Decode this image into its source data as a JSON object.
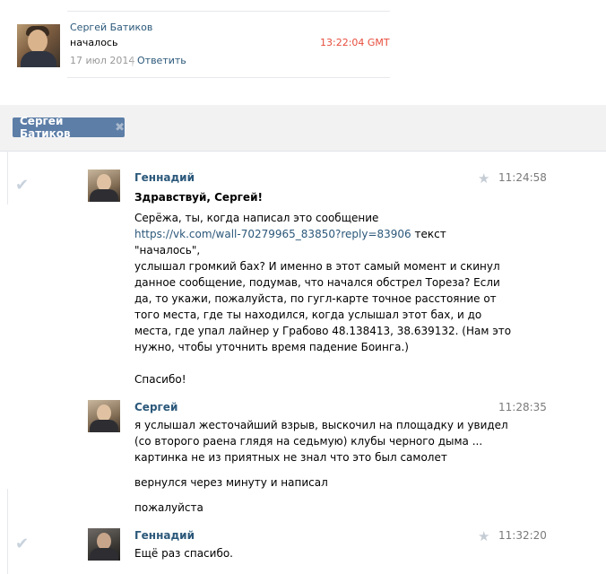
{
  "post": {
    "author": "Сергей Батиков",
    "text": "началось",
    "date": "17 июл 2014",
    "separator": "|",
    "reply": "Ответить",
    "time": "13:22:04 GMT"
  },
  "chat": {
    "tab_name": "Сергей Батиков",
    "tab_close": "✖"
  },
  "messages": [
    {
      "author": "Геннадий",
      "time": "11:24:58",
      "greeting": "Здравствуй, Сергей!",
      "line1": "Серёжа, ты, когда написал это сообщение",
      "link": "https://vk.com/wall-70279965_83850?reply=83906",
      "link_suffix": " текст",
      "line3": "\"началось\",",
      "line4": "услышал громкий бах? И именно в этот самый момент и скинул",
      "line5": "данное сообщение, подумав, что начался обстрел Тореза? Если",
      "line6": "да, то укажи, пожалуйста, по гугл-карте точное расстояние от",
      "line7": "того места, где ты находился, когда услышал этот бах, и до",
      "line8": "места, где упал лайнер у Грабово 48.138413, 38.639132. (Нам это",
      "line9": "нужно, чтобы уточнить время падение Боинга.)",
      "thanks": "Спасибо!"
    },
    {
      "author": "Сергей",
      "time": "11:28:35",
      "line1": "я услышал жесточайший взрыв, выскочил на площадку и увидел",
      "line2": "(со второго раена глядя на седьмую) клубы черного дыма ...",
      "line3": "картинка не из приятных не знал что это был самолет",
      "line4": "вернулся через минуту и написал",
      "line5": "пожалуйста"
    },
    {
      "author": "Геннадий",
      "time": "11:32:20",
      "line1": "Ещё раз спасибо."
    }
  ],
  "icons": {
    "check": "✔",
    "star": "★"
  }
}
